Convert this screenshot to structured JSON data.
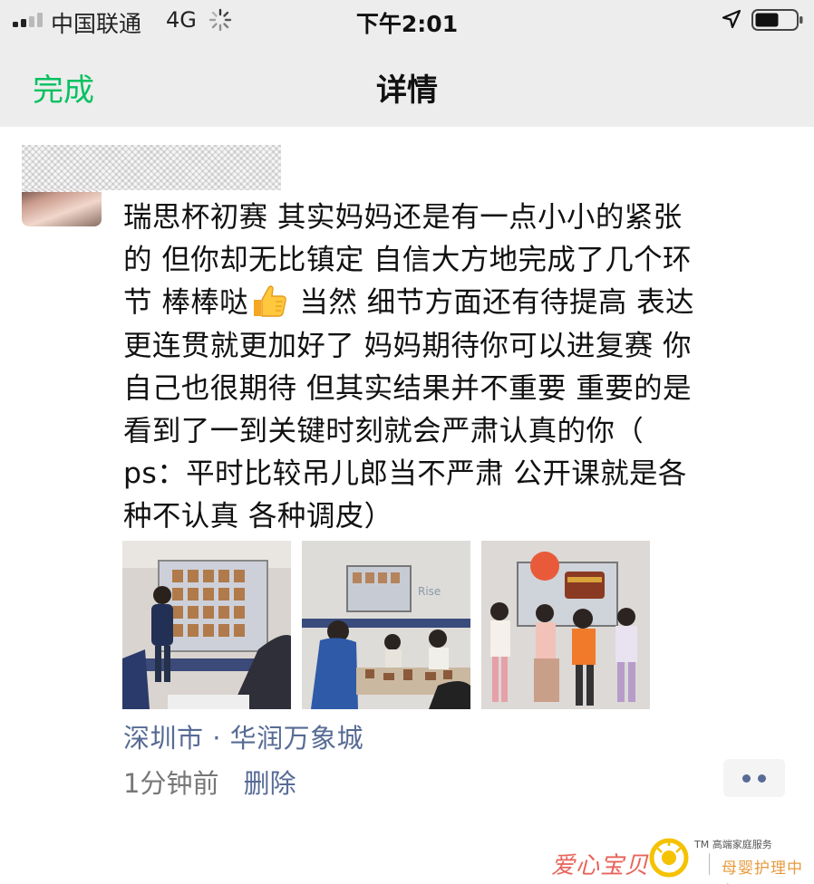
{
  "status_bar": {
    "carrier": "中国联通",
    "network": "4G",
    "time": "下午2:01",
    "icons": [
      "signal-icon",
      "loading-icon",
      "location-arrow-icon",
      "battery-icon"
    ]
  },
  "nav": {
    "done_label": "完成",
    "title": "详情"
  },
  "post": {
    "text_lines": [
      "瑞思杯初赛  其实妈妈还是有一点小小的紧张",
      "的 但你却无比镇定 自信大方地完成了几个环",
      "节 棒棒哒",
      "更连贯就更加好了 妈妈期待你可以进复赛 你",
      "自己也很期待 但其实结果并不重要 重要的是",
      "看到了一到关键时刻就会严肃认真的你（",
      "ps：平时比较吊儿郎当不严肃 公开课就是各",
      "种不认真 各种调皮）"
    ],
    "line3_after_emoji": " 当然 细节方面还有待提高 表达",
    "emoji": "thumbs-up-icon",
    "photos": [
      "classroom-presentation-photo",
      "students-at-desk-photo",
      "kids-holding-trophy-photo"
    ],
    "location": "深圳市 · 华润万象城",
    "time_ago": "1分钟前",
    "delete_label": "删除",
    "more_icon": "more-dots-icon"
  },
  "watermark": {
    "brand": "爱心宝贝",
    "tag": "TM 高端家庭服务",
    "sub": "母婴护理中心"
  },
  "colors": {
    "accent_green": "#07c160",
    "link_blue": "#576b95",
    "bar_bg": "#ededed"
  }
}
